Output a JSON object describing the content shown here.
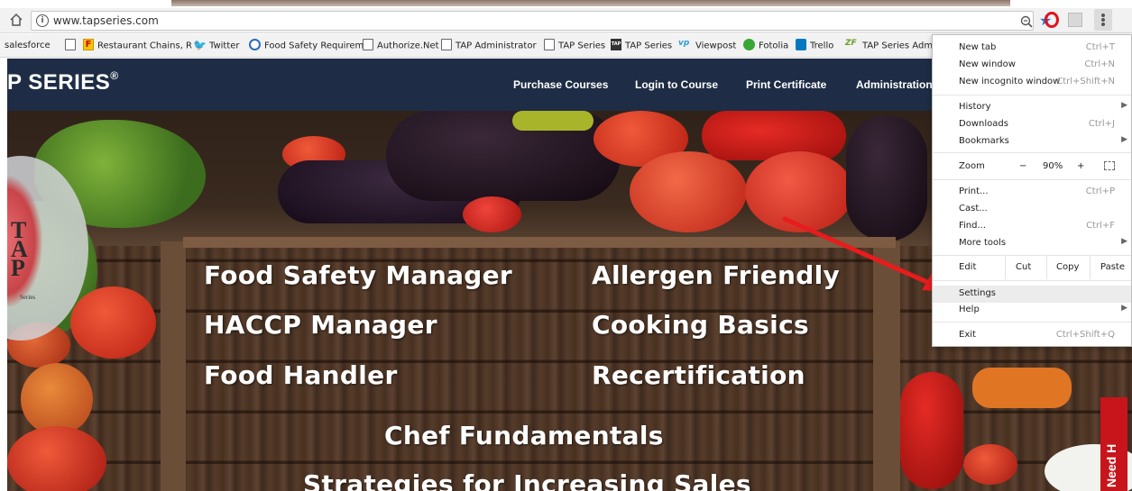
{
  "browser": {
    "url": "www.tapseries.com",
    "bookmarks": [
      {
        "label": "salesforce",
        "icon": "none"
      },
      {
        "label": "",
        "icon": "page"
      },
      {
        "label": "Restaurant Chains, R",
        "icon": "f-icon"
      },
      {
        "label": "Twitter",
        "icon": "twitter-icon"
      },
      {
        "label": "Food Safety Requirem",
        "icon": "fs-icon"
      },
      {
        "label": "Authorize.Net",
        "icon": "page"
      },
      {
        "label": "TAP Administrator",
        "icon": "page"
      },
      {
        "label": "TAP Series",
        "icon": "page"
      },
      {
        "label": "TAP Series",
        "icon": "tap-icon"
      },
      {
        "label": "Viewpost",
        "icon": "vp-icon"
      },
      {
        "label": "Fotolia",
        "icon": "fotolia-icon"
      },
      {
        "label": "Trello",
        "icon": "trello-icon"
      },
      {
        "label": "TAP Series Admin",
        "icon": "zf-icon"
      }
    ]
  },
  "site": {
    "brand": "P SERIES",
    "brand_mark": "®",
    "nav": [
      "Purchase Courses",
      "Login to Course",
      "Print Certificate",
      "Administration"
    ],
    "badge_letters": [
      "T",
      "A",
      "P"
    ],
    "badge_sub": "Series",
    "courses": {
      "food_safety_manager": "Food Safety Manager",
      "allergen_friendly": "Allergen Friendly",
      "haccp_manager": "HACCP Manager",
      "cooking_basics": "Cooking Basics",
      "food_handler": "Food Handler",
      "recertification": "Recertification",
      "chef_fundamentals": "Chef Fundamentals",
      "strategies": "Strategies for Increasing Sales"
    },
    "need_help": "Need H"
  },
  "menu": {
    "new_tab": {
      "label": "New tab",
      "shortcut": "Ctrl+T"
    },
    "new_window": {
      "label": "New window",
      "shortcut": "Ctrl+N"
    },
    "new_incognito": {
      "label": "New incognito window",
      "shortcut": "Ctrl+Shift+N"
    },
    "history": {
      "label": "History"
    },
    "downloads": {
      "label": "Downloads",
      "shortcut": "Ctrl+J"
    },
    "bookmarks": {
      "label": "Bookmarks"
    },
    "zoom": {
      "label": "Zoom",
      "minus": "−",
      "value": "90%",
      "plus": "+"
    },
    "print": {
      "label": "Print...",
      "shortcut": "Ctrl+P"
    },
    "cast": {
      "label": "Cast..."
    },
    "find": {
      "label": "Find...",
      "shortcut": "Ctrl+F"
    },
    "more_tools": {
      "label": "More tools"
    },
    "edit": {
      "label": "Edit",
      "cut": "Cut",
      "copy": "Copy",
      "paste": "Paste"
    },
    "settings": {
      "label": "Settings"
    },
    "help": {
      "label": "Help"
    },
    "exit": {
      "label": "Exit",
      "shortcut": "Ctrl+Shift+Q"
    }
  },
  "colors": {
    "site_header": "#1e2d45",
    "arrow": "#e81c1c",
    "star": "#2b6fd6",
    "need_help": "#c8141b"
  }
}
